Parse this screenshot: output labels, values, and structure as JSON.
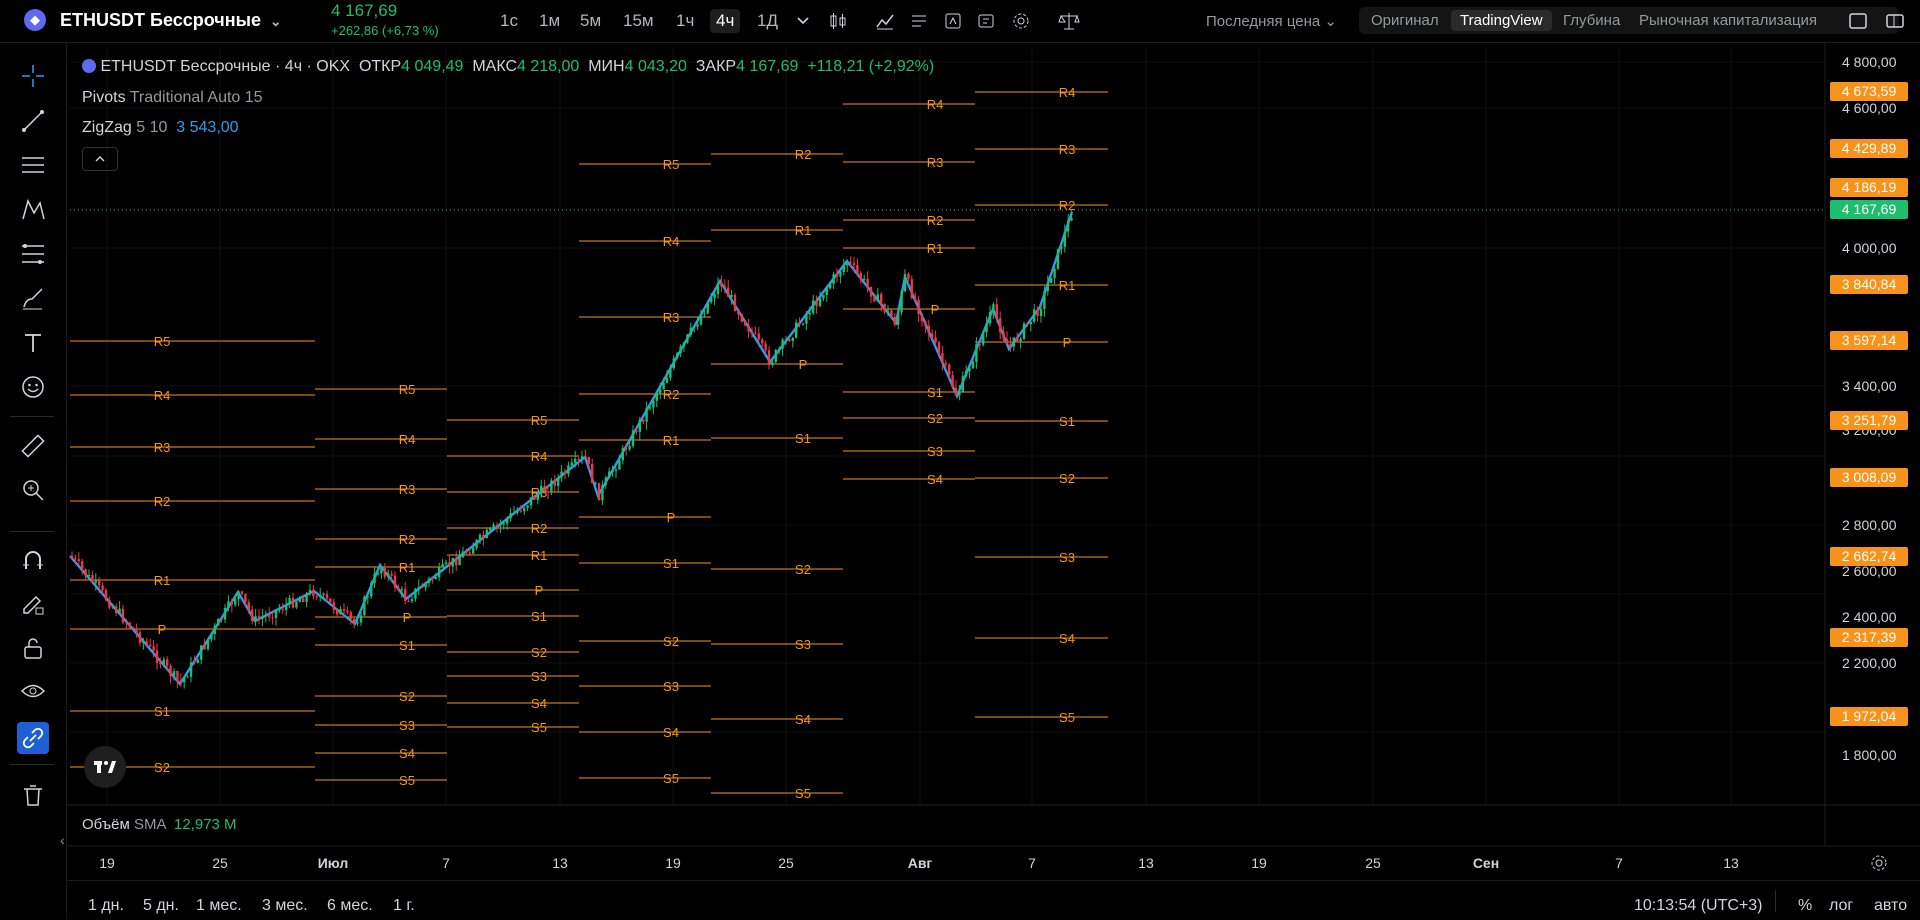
{
  "topbar": {
    "symbol": "ETHUSDT Бессрочные",
    "price": "4 167,69",
    "change": "+262,86 (+6,73 %)",
    "timeframes": [
      "1с",
      "1м",
      "5м",
      "15м",
      "1ч",
      "4ч",
      "1Д"
    ],
    "active_timeframe": "4ч",
    "price_type": "Последняя цена",
    "segments": [
      "Оригинал",
      "TradingView",
      "Глубина",
      "Рыночная капитализация"
    ],
    "active_segment": "TradingView"
  },
  "legend": {
    "title": "ETHUSDT Бессрочные · 4ч · OKX",
    "open_label": "ОТКР",
    "open": "4 049,49",
    "high_label": "МАКС",
    "high": "4 218,00",
    "low_label": "МИН",
    "low": "4 043,20",
    "close_label": "ЗАКР",
    "close": "4 167,69",
    "change": "+118,21 (+2,92%)",
    "pivots_name": "Pivots",
    "pivots_params": "Traditional Auto 15",
    "zigzag_name": "ZigZag",
    "zigzag_params": "5 10",
    "zigzag_value": "3 543,00"
  },
  "volume": {
    "label": "Объём",
    "ma": "SMA",
    "value": "12,973 M"
  },
  "y_axis": {
    "ticks": [
      "4 800,00",
      "4 600,00",
      "4 000,00",
      "3 400,00",
      "3 200,00",
      "2 800,00",
      "2 600,00",
      "2 400,00",
      "2 200,00",
      "1 800,00"
    ],
    "badges": [
      {
        "text": "4 673,59",
        "color": "#f7931a"
      },
      {
        "text": "4 429,89",
        "color": "#f7931a"
      },
      {
        "text": "4 186,19",
        "color": "#f7931a"
      },
      {
        "text": "4 167,69",
        "color": "#1ebd70"
      },
      {
        "text": "3 840,84",
        "color": "#f7931a"
      },
      {
        "text": "3 597,14",
        "color": "#f7931a"
      },
      {
        "text": "3 251,79",
        "color": "#f7931a"
      },
      {
        "text": "3 008,09",
        "color": "#f7931a"
      },
      {
        "text": "2 662,74",
        "color": "#f7931a"
      },
      {
        "text": "2 317,39",
        "color": "#f7931a"
      },
      {
        "text": "1 972,04",
        "color": "#f7931a"
      }
    ]
  },
  "x_axis": {
    "labels": [
      "19",
      "25",
      "Июл",
      "7",
      "13",
      "19",
      "25",
      "Авг",
      "7",
      "13",
      "19",
      "25",
      "Сен",
      "7",
      "13"
    ]
  },
  "pivot_labels": [
    "P",
    "R1",
    "R2",
    "R3",
    "R4",
    "R5",
    "S1",
    "S2",
    "S3",
    "S4",
    "S5"
  ],
  "bottombar": {
    "ranges": [
      "1 дн.",
      "5 дн.",
      "1 мес.",
      "3 мес.",
      "6 мес.",
      "1 г."
    ],
    "time": "10:13:54 (UTC+3)",
    "percent": "%",
    "log": "лог",
    "auto": "авто"
  },
  "colors": {
    "up": "#1ebd70",
    "down": "#f23645",
    "pivot": "#f7931a",
    "zigzag": "#2f9cf0"
  }
}
